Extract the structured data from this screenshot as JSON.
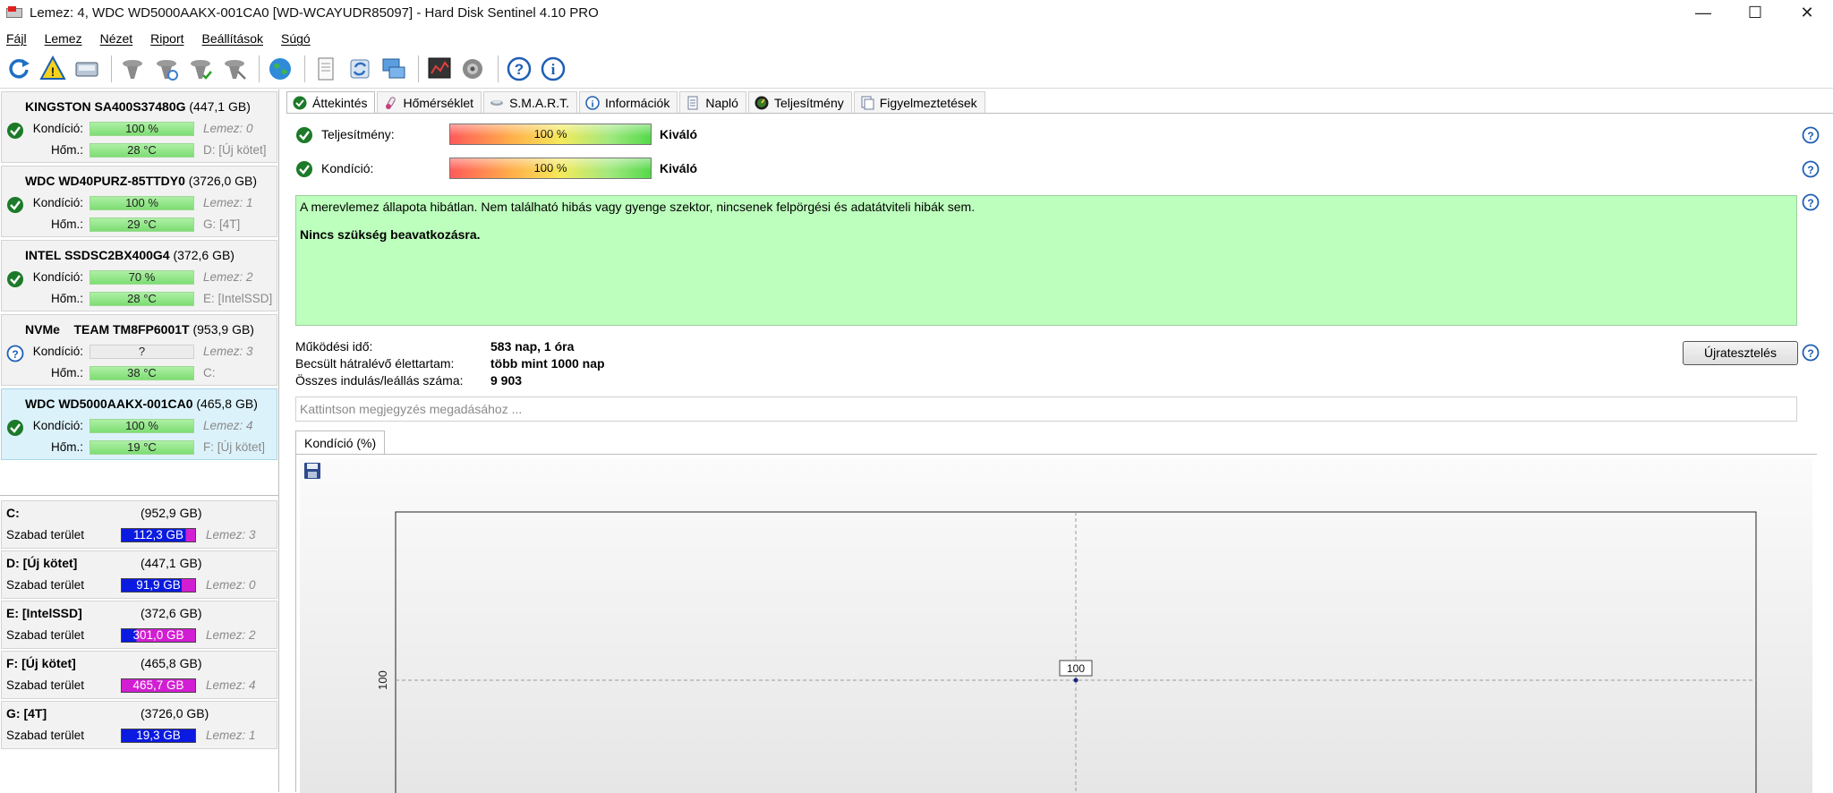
{
  "window": {
    "title": "Lemez: 4, WDC WD5000AAKX-001CA0 [WD-WCAYUDR85097]  -  Hard Disk Sentinel 4.10 PRO",
    "controls": {
      "minimize": "—",
      "maximize": "☐",
      "close": "✕"
    }
  },
  "menu": [
    "Fájl",
    "Lemez",
    "Nézet",
    "Riport",
    "Beállítások",
    "Súgó"
  ],
  "toolbar": {
    "icons": [
      "refresh-icon",
      "alert-icon",
      "disk-icon",
      "drive-gray-icon",
      "drive-refresh-icon",
      "drive-check-icon",
      "drive-off-icon",
      "globe-icon",
      "report-icon",
      "sync-icon",
      "network-icon",
      "chart-icon",
      "sound-icon",
      "help-icon",
      "info-icon"
    ]
  },
  "disks": [
    {
      "name": "KINGSTON SA400S37480G",
      "size": "(447,1 GB)",
      "cond_label": "Kondíció:",
      "cond": "100 %",
      "cond_pct": 100,
      "temp_label": "Hőm.:",
      "temp": "28 °C",
      "lemez": "Lemez: 0",
      "drive": "D: [Új kötet]",
      "status": "ok"
    },
    {
      "name": "WDC WD40PURZ-85TTDY0",
      "size": "(3726,0 GB)",
      "cond_label": "Kondíció:",
      "cond": "100 %",
      "cond_pct": 100,
      "temp_label": "Hőm.:",
      "temp": "29 °C",
      "lemez": "Lemez: 1",
      "drive": "G: [4T]",
      "status": "ok"
    },
    {
      "name": "INTEL SSDSC2BX400G4",
      "size": "(372,6 GB)",
      "cond_label": "Kondíció:",
      "cond": "70 %",
      "cond_pct": 70,
      "temp_label": "Hőm.:",
      "temp": "28 °C",
      "lemez": "Lemez: 2",
      "drive": "E: [IntelSSD]",
      "status": "ok"
    },
    {
      "name": "NVMe    TEAM TM8FP6001T",
      "size": "(953,9 GB)",
      "cond_label": "Kondíció:",
      "cond": "?",
      "cond_pct": 0,
      "temp_label": "Hőm.:",
      "temp": "38 °C",
      "lemez": "Lemez: 3",
      "drive": "C:",
      "status": "unknown"
    },
    {
      "name": "WDC WD5000AAKX-001CA0",
      "size": "(465,8 GB)",
      "cond_label": "Kondíció:",
      "cond": "100 %",
      "cond_pct": 100,
      "temp_label": "Hőm.:",
      "temp": "19 °C",
      "lemez": "Lemez: 4",
      "drive": "F: [Új kötet]",
      "status": "ok",
      "selected": true
    }
  ],
  "volumes": [
    {
      "name": "C:",
      "size": "(952,9 GB)",
      "label": "Szabad terület",
      "free": "112,3 GB",
      "lemez": "Lemez: 3",
      "color": "#0a1ae0",
      "used_color": "#d21ed2",
      "free_fraction": 0.87
    },
    {
      "name": "D: [Új kötet]",
      "size": "(447,1 GB)",
      "label": "Szabad terület",
      "free": "91,9 GB",
      "lemez": "Lemez: 0",
      "color": "#0a1ae0",
      "used_color": "#d21ed2",
      "free_fraction": 0.82
    },
    {
      "name": "E: [IntelSSD]",
      "size": "(372,6 GB)",
      "label": "Szabad terület",
      "free": "301,0 GB",
      "lemez": "Lemez: 2",
      "color": "#0a1ae0",
      "used_color": "#d21ed2",
      "free_fraction": 0.2
    },
    {
      "name": "F: [Új kötet]",
      "size": "(465,8 GB)",
      "label": "Szabad terület",
      "free": "465,7 GB",
      "lemez": "Lemez: 4",
      "color": "#0a1ae0",
      "used_color": "#d21ed2",
      "free_fraction": 0.0
    },
    {
      "name": "G: [4T]",
      "size": "(3726,0 GB)",
      "label": "Szabad terület",
      "free": "19,3 GB",
      "lemez": "Lemez: 1",
      "color": "#0a1ae0",
      "used_color": "#d21ed2",
      "free_fraction": 1.0
    }
  ],
  "tabs": [
    "Áttekintés",
    "Hőmérséklet",
    "S.M.A.R.T.",
    "Információk",
    "Napló",
    "Teljesítmény",
    "Figyelmeztetések"
  ],
  "overview": {
    "performance_label": "Teljesítmény:",
    "performance_value": "100 %",
    "performance_word": "Kiváló",
    "condition_label": "Kondíció:",
    "condition_value": "100 %",
    "condition_word": "Kiváló",
    "message": "A merevlemez állapota hibátlan. Nem található hibás vagy gyenge szektor, nincsenek felpörgési és adatátviteli hibák sem.",
    "action": "Nincs szükség beavatkozásra.",
    "stats": [
      {
        "k": "Működési idő:",
        "v": "583 nap, 1 óra"
      },
      {
        "k": "Becsült hátralévő élettartam:",
        "v": "több mint 1000 nap"
      },
      {
        "k": "Összes indulás/leállás száma:",
        "v": "9 903"
      }
    ],
    "retest_label": "Újratesztelés",
    "note_placeholder": "Kattintson megjegyzés megadásához ...",
    "chart_tab": "Kondíció  (%)"
  },
  "chart_data": {
    "type": "line",
    "title": "",
    "xlabel": "",
    "ylabel": "",
    "y_ticks": [
      "100"
    ],
    "series": [
      {
        "values": [
          100
        ]
      }
    ],
    "data_labels": [
      "100"
    ]
  }
}
